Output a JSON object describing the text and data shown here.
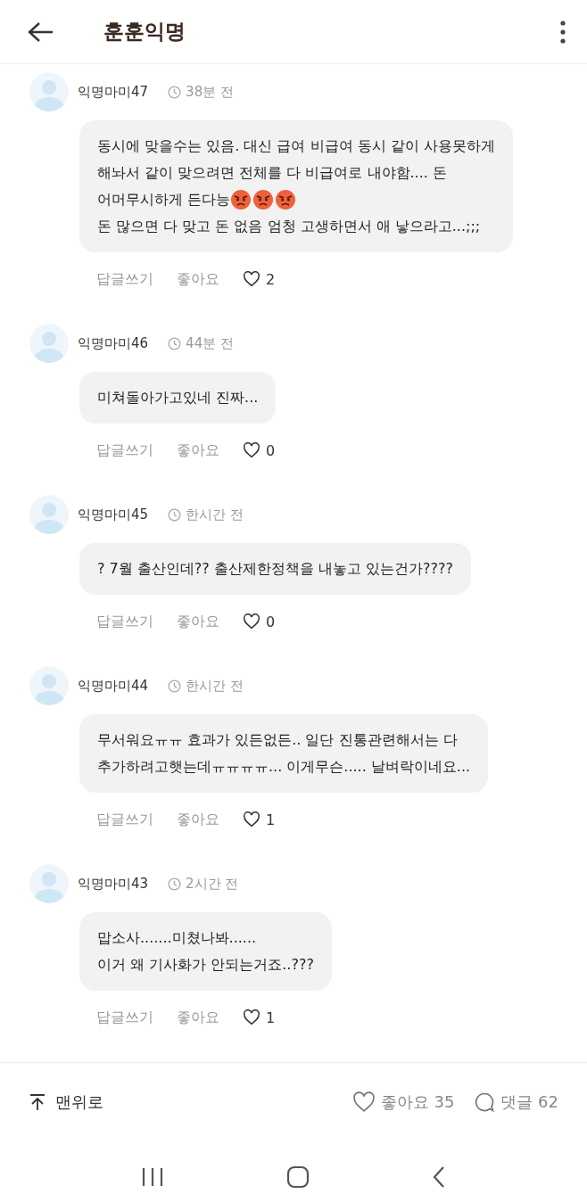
{
  "header": {
    "title": "훈훈익명"
  },
  "comments": [
    {
      "author": "익명마미47",
      "time": "38분 전",
      "parts": [
        {
          "kind": "text",
          "text": "동시에 맞을수는 있음. 대신 급여 비급여 동시 같이 사용못하게\n해놔서 같이 맞으려면 전체를 다 비급여로 내야함.... 돈"
        },
        {
          "kind": "text",
          "text": "어머무시하게 든다능",
          "emojis": [
            {
              "kind": "angry"
            },
            {
              "kind": "angry"
            },
            {
              "kind": "angry"
            }
          ]
        },
        {
          "kind": "text",
          "text": "돈 많으면 다 맞고 돈 없음 엄청 고생하면서 애 낳으라고...;;;"
        }
      ],
      "reply": "답글쓰기",
      "like": "좋아요",
      "likes": "2"
    },
    {
      "author": "익명마미46",
      "time": "44분 전",
      "parts": [
        {
          "kind": "text",
          "text": "미쳐돌아가고있네 진짜..."
        }
      ],
      "reply": "답글쓰기",
      "like": "좋아요",
      "likes": "0"
    },
    {
      "author": "익명마미45",
      "time": "한시간 전",
      "parts": [
        {
          "kind": "text",
          "text": "? 7월 출산인데?? 출산제한정책을 내놓고 있는건가????"
        }
      ],
      "reply": "답글쓰기",
      "like": "좋아요",
      "likes": "0"
    },
    {
      "author": "익명마미44",
      "time": "한시간 전",
      "parts": [
        {
          "kind": "text",
          "text": "무서워요ㅠㅠ 효과가 있든없든.. 일단 진통관련해서는 다\n추가하려고햇는데ㅠㅠㅠㅠ... 이게무슨..... 날벼락이네요..."
        }
      ],
      "reply": "답글쓰기",
      "like": "좋아요",
      "likes": "1"
    },
    {
      "author": "익명마미43",
      "time": "2시간 전",
      "parts": [
        {
          "kind": "text",
          "text": "맙소사.......미쳤나봐......\n이거 왜 기사화가 안되는거죠..???"
        }
      ],
      "reply": "답글쓰기",
      "like": "좋아요",
      "likes": "1"
    }
  ],
  "footer": {
    "top": "맨위로",
    "like": "좋아요 35",
    "comments": "댓글 62"
  }
}
